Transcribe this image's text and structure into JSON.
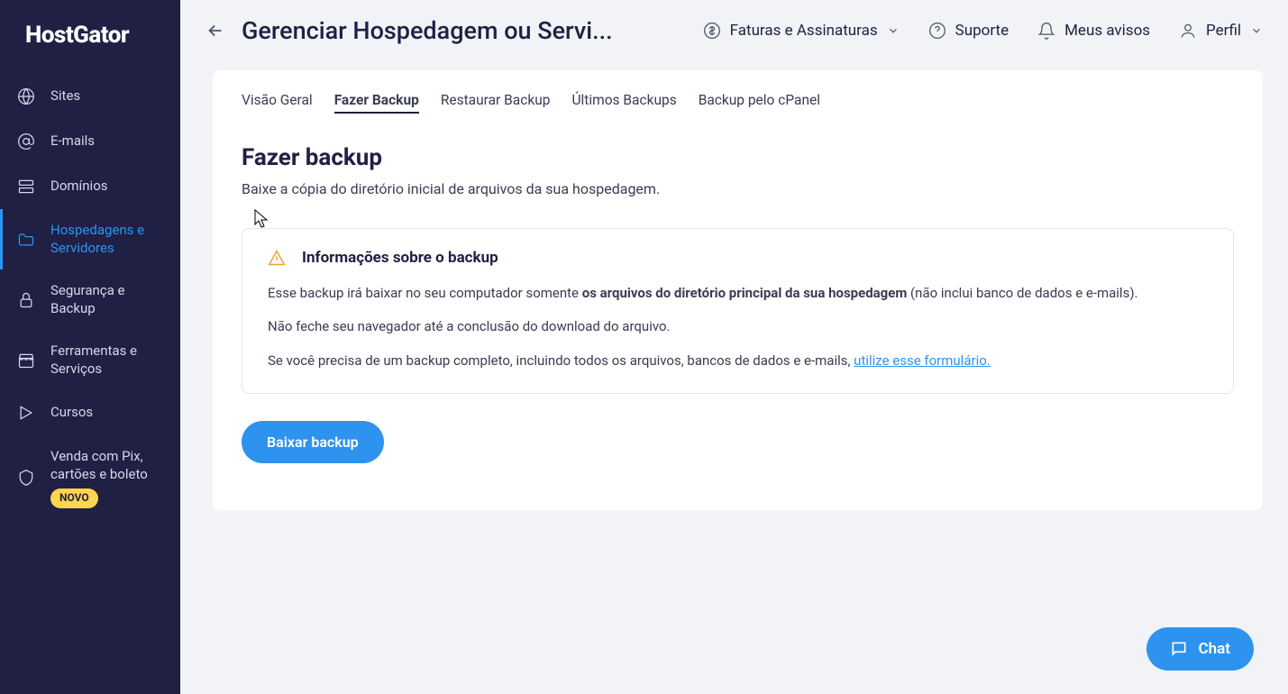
{
  "brand": "HostGator",
  "sidebar": {
    "items": [
      {
        "label": "Sites"
      },
      {
        "label": "E-mails"
      },
      {
        "label": "Domínios"
      },
      {
        "label": "Hospedagens e Servidores"
      },
      {
        "label": "Segurança e Backup"
      },
      {
        "label": "Ferramentas e Serviços"
      },
      {
        "label": "Cursos"
      },
      {
        "label": "Venda com Pix, cartões e boleto",
        "badge": "NOVO"
      }
    ]
  },
  "topbar": {
    "title": "Gerenciar Hospedagem ou Servi...",
    "actions": {
      "billing": "Faturas e Assinaturas",
      "support": "Suporte",
      "notices": "Meus avisos",
      "profile": "Perfil"
    }
  },
  "tabs": [
    "Visão Geral",
    "Fazer Backup",
    "Restaurar Backup",
    "Últimos Backups",
    "Backup pelo cPanel"
  ],
  "active_tab_index": 1,
  "section": {
    "heading": "Fazer backup",
    "description": "Baixe a cópia do diretório inicial de arquivos da sua hospedagem."
  },
  "info": {
    "title": "Informações sobre o backup",
    "line1_a": "Esse backup irá baixar no seu computador somente ",
    "line1_strong": "os arquivos do diretório principal da sua hospedagem",
    "line1_b": " (não inclui banco de dados e e-mails).",
    "line2": "Não feche seu navegador até a conclusão do download do arquivo.",
    "line3_a": "Se você precisa de um backup completo, incluindo todos os arquivos, bancos de dados e e-mails, ",
    "line3_link": "utilize esse formulário."
  },
  "button": "Baixar backup",
  "chat": "Chat"
}
